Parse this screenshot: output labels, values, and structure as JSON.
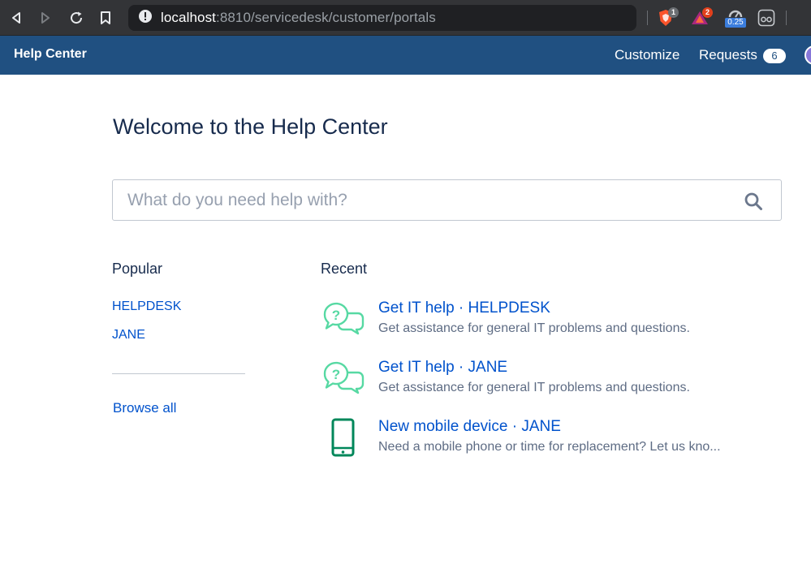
{
  "browser": {
    "url_host": "localhost",
    "url_path": ":8810/servicedesk/customer/portals",
    "ext_brave_count": "1",
    "ext_triangle_count": "2",
    "ext_speed_value": "0.25"
  },
  "header": {
    "title": "Help Center",
    "customize_label": "Customize",
    "requests_label": "Requests",
    "requests_count": "6"
  },
  "main": {
    "title": "Welcome to the Help Center",
    "search_placeholder": "What do you need help with?",
    "popular": {
      "heading": "Popular",
      "items": [
        "HELPDESK",
        "JANE"
      ],
      "browse_all": "Browse all"
    },
    "recent": {
      "heading": "Recent",
      "items": [
        {
          "title": "Get IT help · HELPDESK",
          "description": "Get assistance for general IT problems and questions.",
          "icon": "chat-question-icon"
        },
        {
          "title": "Get IT help · JANE",
          "description": "Get assistance for general IT problems and questions.",
          "icon": "chat-question-icon"
        },
        {
          "title": "New mobile device · JANE",
          "description": "Need a mobile phone or time for replacement? Let us kno...",
          "icon": "mobile-phone-icon"
        }
      ]
    }
  },
  "colors": {
    "header_bg": "#205081",
    "link": "#0052cc",
    "chat_icon": "#57d9a3",
    "phone_icon": "#00875a"
  }
}
